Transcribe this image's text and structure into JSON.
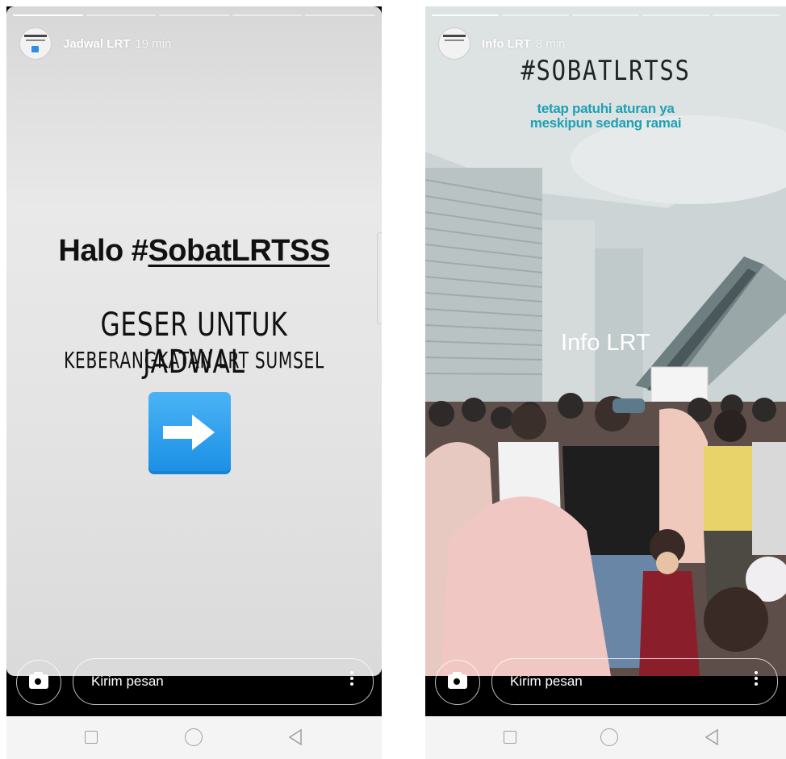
{
  "left": {
    "username": "Jadwal LRT",
    "time": "19 min",
    "halo_prefix": "Halo #",
    "halo_tag": "SobatLRTSS",
    "line1": "GESER UNTUK JADWAL",
    "line2": "KEBERANGKATAN LRT SUMSEL",
    "message_placeholder": "Kirim pesan",
    "arrow_icon": "right-arrow-emoji"
  },
  "right": {
    "username": "Info LRT",
    "time": "8 min",
    "hashtag": "#SOBATLRTSS",
    "caption_line1": "tetap patuhi aturan ya",
    "caption_line2": "meskipun sedang ramai",
    "location_label": "Info LRT",
    "message_placeholder": "Kirim pesan"
  },
  "colors": {
    "accent_teal": "#1fa0b5",
    "arrow_blue": "#1a8fe4"
  }
}
